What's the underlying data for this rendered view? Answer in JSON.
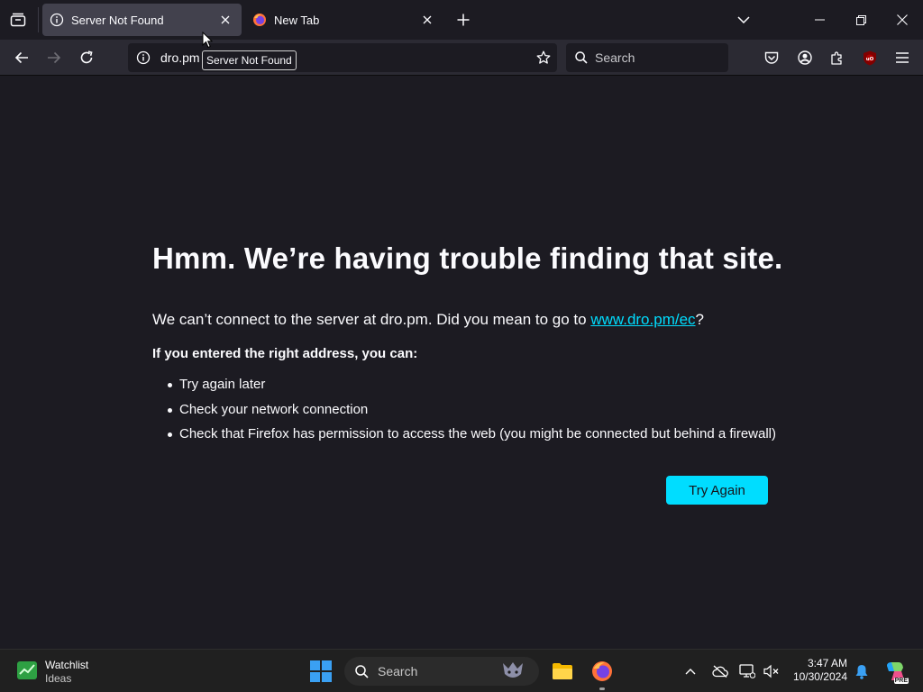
{
  "tabs": [
    {
      "title": "Server Not Found",
      "active": true
    },
    {
      "title": "New Tab",
      "active": false
    }
  ],
  "nav": {
    "url": "dro.pm",
    "search_placeholder": "Search"
  },
  "tooltip": "Server Not Found",
  "error": {
    "title": "Hmm. We’re having trouble finding that site.",
    "message_prefix": "We can’t connect to the server at dro.pm. Did you mean to go to ",
    "suggested_link": "www.dro.pm/ec",
    "message_suffix": "?",
    "subtitle": "If you entered the right address, you can:",
    "suggestions": [
      "Try again later",
      "Check your network connection",
      "Check that Firefox has permission to access the web (you might be connected but behind a firewall)"
    ],
    "try_again_label": "Try Again"
  },
  "taskbar": {
    "widget_title": "Watchlist",
    "widget_subtitle": "Ideas",
    "search_placeholder": "Search",
    "time": "3:47 AM",
    "date": "10/30/2024",
    "copilot_badge": "PRE"
  },
  "colors": {
    "accent": "#00ddff",
    "background": "#1c1b22",
    "toolbar": "#2b2a33",
    "active_tab": "#42414d"
  }
}
